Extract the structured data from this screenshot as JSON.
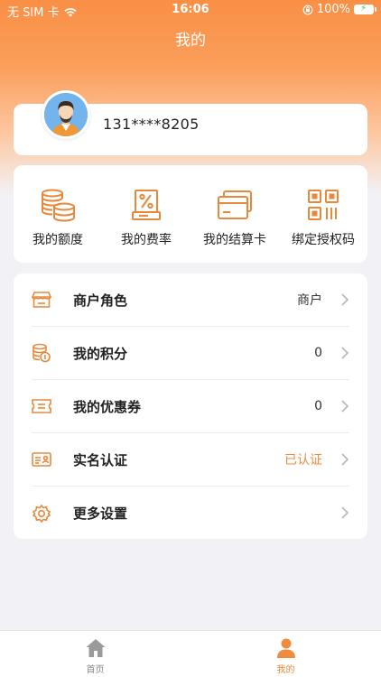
{
  "status_bar": {
    "carrier": "无 SIM 卡",
    "time": "16:06",
    "battery": "100%"
  },
  "nav": {
    "title": "我的"
  },
  "profile": {
    "phone": "131****8205"
  },
  "quick_actions": [
    {
      "label": "我的额度",
      "icon": "coins-stack-icon"
    },
    {
      "label": "我的费率",
      "icon": "rate-percent-icon"
    },
    {
      "label": "我的结算卡",
      "icon": "bank-card-icon"
    },
    {
      "label": "绑定授权码",
      "icon": "qr-code-icon"
    }
  ],
  "menu": [
    {
      "label": "商户角色",
      "value": "商户",
      "icon": "store-icon"
    },
    {
      "label": "我的积分",
      "value": "0",
      "icon": "points-icon"
    },
    {
      "label": "我的优惠券",
      "value": "0",
      "icon": "coupon-icon"
    },
    {
      "label": "实名认证",
      "value": "已认证",
      "icon": "id-card-icon"
    },
    {
      "label": "更多设置",
      "value": "",
      "icon": "settings-gear-icon"
    }
  ],
  "tabbar": [
    {
      "label": "首页",
      "icon": "home-icon",
      "active": false
    },
    {
      "label": "我的",
      "icon": "person-icon",
      "active": true
    }
  ],
  "colors": {
    "accent": "#f08c3e",
    "header_top": "#f98f45",
    "background": "#f2f1f6"
  }
}
